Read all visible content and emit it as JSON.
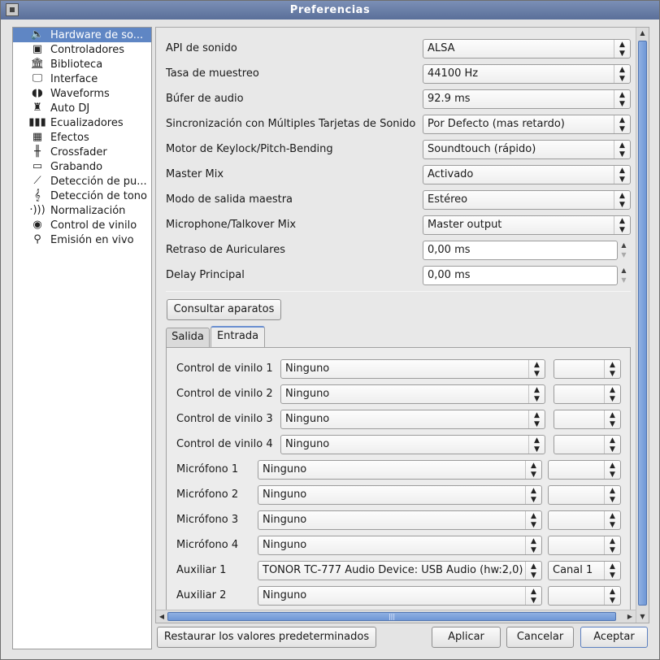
{
  "window": {
    "title": "Preferencias"
  },
  "sidebar": {
    "items": [
      {
        "label": "Hardware de so...",
        "icon": "speaker-icon"
      },
      {
        "label": "Controladores",
        "icon": "controller-icon"
      },
      {
        "label": "Biblioteca",
        "icon": "library-icon"
      },
      {
        "label": "Interface",
        "icon": "monitor-icon"
      },
      {
        "label": "Waveforms",
        "icon": "waveform-icon"
      },
      {
        "label": "Auto DJ",
        "icon": "robot-icon"
      },
      {
        "label": "Ecualizadores",
        "icon": "equalizer-icon"
      },
      {
        "label": "Efectos",
        "icon": "effects-icon"
      },
      {
        "label": "Crossfader",
        "icon": "crossfader-icon"
      },
      {
        "label": "Grabando",
        "icon": "recording-icon"
      },
      {
        "label": "Detección de pu...",
        "icon": "beat-detection-icon"
      },
      {
        "label": "Detección de tono",
        "icon": "key-detection-icon"
      },
      {
        "label": "Normalización",
        "icon": "normalization-icon"
      },
      {
        "label": "Control de vinilo",
        "icon": "vinyl-icon"
      },
      {
        "label": "Emisión en vivo",
        "icon": "broadcast-icon"
      }
    ]
  },
  "settings": [
    {
      "label": "API de sonido",
      "value": "ALSA"
    },
    {
      "label": "Tasa de muestreo",
      "value": "44100 Hz"
    },
    {
      "label": "Búfer de audio",
      "value": "92.9 ms"
    },
    {
      "label": "Sincronización con Múltiples Tarjetas de Sonido",
      "value": "Por Defecto (mas retardo)"
    },
    {
      "label": "Motor de Keylock/Pitch-Bending",
      "value": "Soundtouch (rápido)"
    },
    {
      "label": "Master Mix",
      "value": "Activado"
    },
    {
      "label": "Modo de salida maestra",
      "value": "Estéreo"
    },
    {
      "label": "Microphone/Talkover Mix",
      "value": "Master output"
    },
    {
      "label": "Retraso de Auriculares",
      "value": "0,00 ms"
    },
    {
      "label": "Delay Principal",
      "value": "0,00 ms"
    }
  ],
  "query_devices_button": "Consultar aparatos",
  "tabs": [
    {
      "label": "Salida"
    },
    {
      "label": "Entrada"
    }
  ],
  "inputs": [
    {
      "label": "Control de vinilo 1",
      "device": "Ninguno",
      "channel": ""
    },
    {
      "label": "Control de vinilo 2",
      "device": "Ninguno",
      "channel": ""
    },
    {
      "label": "Control de vinilo 3",
      "device": "Ninguno",
      "channel": ""
    },
    {
      "label": "Control de vinilo 4",
      "device": "Ninguno",
      "channel": ""
    },
    {
      "label": "Micrófono 1",
      "device": "Ninguno",
      "channel": ""
    },
    {
      "label": "Micrófono 2",
      "device": "Ninguno",
      "channel": ""
    },
    {
      "label": "Micrófono 3",
      "device": "Ninguno",
      "channel": ""
    },
    {
      "label": "Micrófono 4",
      "device": "Ninguno",
      "channel": ""
    },
    {
      "label": "Auxiliar 1",
      "device": "TONOR TC-777 Audio Device: USB Audio (hw:2,0)",
      "channel": "Canal 1"
    },
    {
      "label": "Auxiliar 2",
      "device": "Ninguno",
      "channel": ""
    }
  ],
  "footer": {
    "restore": "Restaurar los valores predeterminados",
    "apply": "Aplicar",
    "cancel": "Cancelar",
    "accept": "Aceptar"
  }
}
